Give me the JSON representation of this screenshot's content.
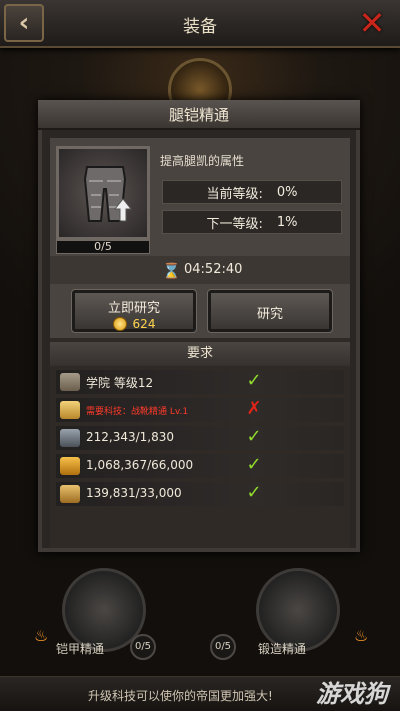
{
  "header": {
    "title": "装备",
    "back_icon": "back-arrow-icon",
    "close_icon": "close-x-icon"
  },
  "dialog": {
    "title": "腿铠精通",
    "item": {
      "icon": "leg-armor-icon",
      "progress": "0/5"
    },
    "description": "提高腿凯的属性",
    "current_level": {
      "label": "当前等级:",
      "value": "0%"
    },
    "next_level": {
      "label": "下一等级:",
      "value": "1%"
    },
    "timer": "04:52:40",
    "instant_button": {
      "label": "立即研究",
      "cost": "624"
    },
    "research_button": {
      "label": "研究"
    },
    "requirements_title": "要求",
    "requirements": [
      {
        "icon": "academy-icon",
        "text": "学院 等级12",
        "met": true
      },
      {
        "icon": "scroll-icon",
        "text": "需要科技：战靴精通 Lv.1",
        "met": false
      },
      {
        "icon": "iron-ore-icon",
        "text": "212,343/1,830",
        "met": true
      },
      {
        "icon": "feather-icon",
        "text": "1,068,367/66,000",
        "met": true
      },
      {
        "icon": "wood-icon",
        "text": "139,831/33,000",
        "met": true
      }
    ]
  },
  "tree": {
    "left": {
      "label": "铠甲精通",
      "count": "0/5"
    },
    "right": {
      "label": "锻造精通",
      "count": "0/5"
    }
  },
  "footer": {
    "hint": "升级科技可以使你的帝国更加强大!"
  },
  "watermark": "游戏狗",
  "colors": {
    "met": "#8fdc2a",
    "unmet": "#e0241a",
    "gold": "#ffd34d",
    "warning_text": "#ff3a2a"
  }
}
